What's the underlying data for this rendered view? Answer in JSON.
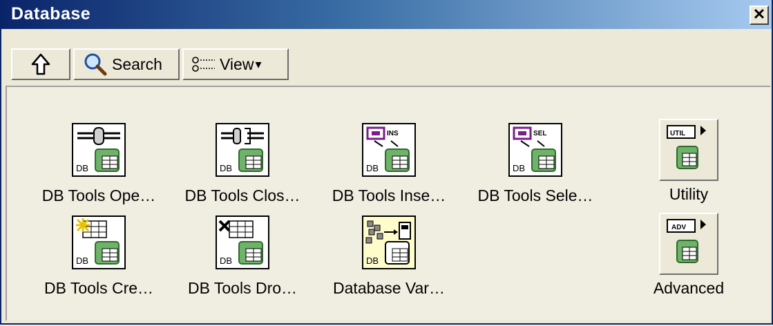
{
  "window": {
    "title": "Database",
    "close_glyph": "✕"
  },
  "toolbar": {
    "up_icon": "up-arrow-icon",
    "search_label": "Search",
    "view_label": "View",
    "view_caret": "▾"
  },
  "palette": {
    "items": [
      {
        "label": "DB Tools Ope…",
        "icon": "open-connection-icon",
        "tag": "DB"
      },
      {
        "label": "DB Tools Clos…",
        "icon": "close-connection-icon",
        "tag": "DB"
      },
      {
        "label": "DB Tools Inse…",
        "icon": "insert-data-icon",
        "tag": "DB",
        "code": "INS"
      },
      {
        "label": "DB Tools Sele…",
        "icon": "select-data-icon",
        "tag": "DB",
        "code": "SEL"
      },
      {
        "label": "DB Tools Cre…",
        "icon": "create-table-icon",
        "tag": "DB"
      },
      {
        "label": "DB Tools Dro…",
        "icon": "drop-table-icon",
        "tag": "DB"
      },
      {
        "label": "Database Var…",
        "icon": "database-variant-icon",
        "tag": "DB"
      }
    ],
    "subpalettes": [
      {
        "label": "Utility",
        "code": "UTIL",
        "icon": "utility-subpalette-icon"
      },
      {
        "label": "Advanced",
        "code": "ADV",
        "icon": "advanced-subpalette-icon"
      }
    ],
    "colors": {
      "accent_purple": "#7a1e8c",
      "db_green": "#3f8a3a",
      "titlebar": "#0a246a"
    }
  }
}
